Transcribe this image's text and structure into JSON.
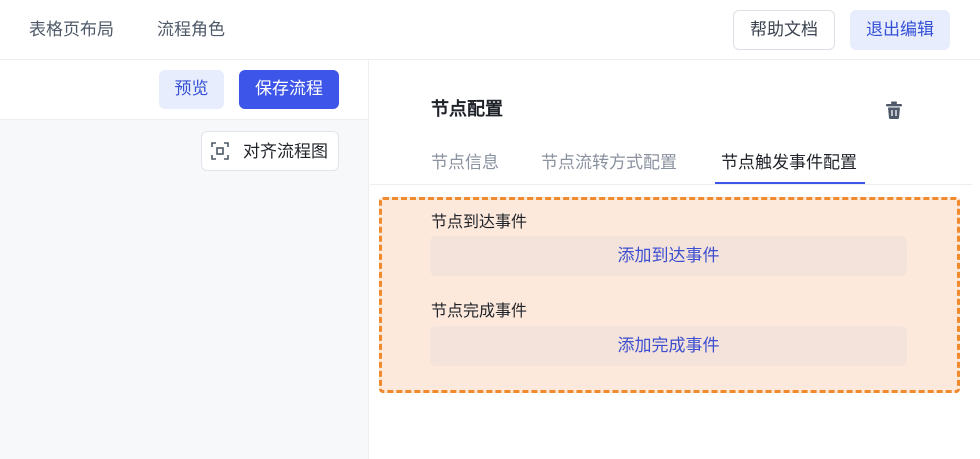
{
  "topbar": {
    "tabs": [
      {
        "label": "表格页布局"
      },
      {
        "label": "流程角色"
      }
    ],
    "help_label": "帮助文档",
    "exit_label": "退出编辑"
  },
  "left": {
    "preview_label": "预览",
    "save_label": "保存流程",
    "align_label": "对齐流程图",
    "align_icon": "align-center-icon"
  },
  "right": {
    "title": "节点配置",
    "delete_icon": "trash-icon",
    "tabs": [
      {
        "label": "节点信息",
        "active": false
      },
      {
        "label": "节点流转方式配置",
        "active": false
      },
      {
        "label": "节点触发事件配置",
        "active": true
      }
    ],
    "events": {
      "arrive_label": "节点到达事件",
      "arrive_button": "添加到达事件",
      "complete_label": "节点完成事件",
      "complete_button": "添加完成事件"
    }
  },
  "colors": {
    "primary": "#3d55e8",
    "primary_light": "#e8edfd",
    "highlight_border": "#f08a2c",
    "highlight_fill": "#fde9dc"
  }
}
